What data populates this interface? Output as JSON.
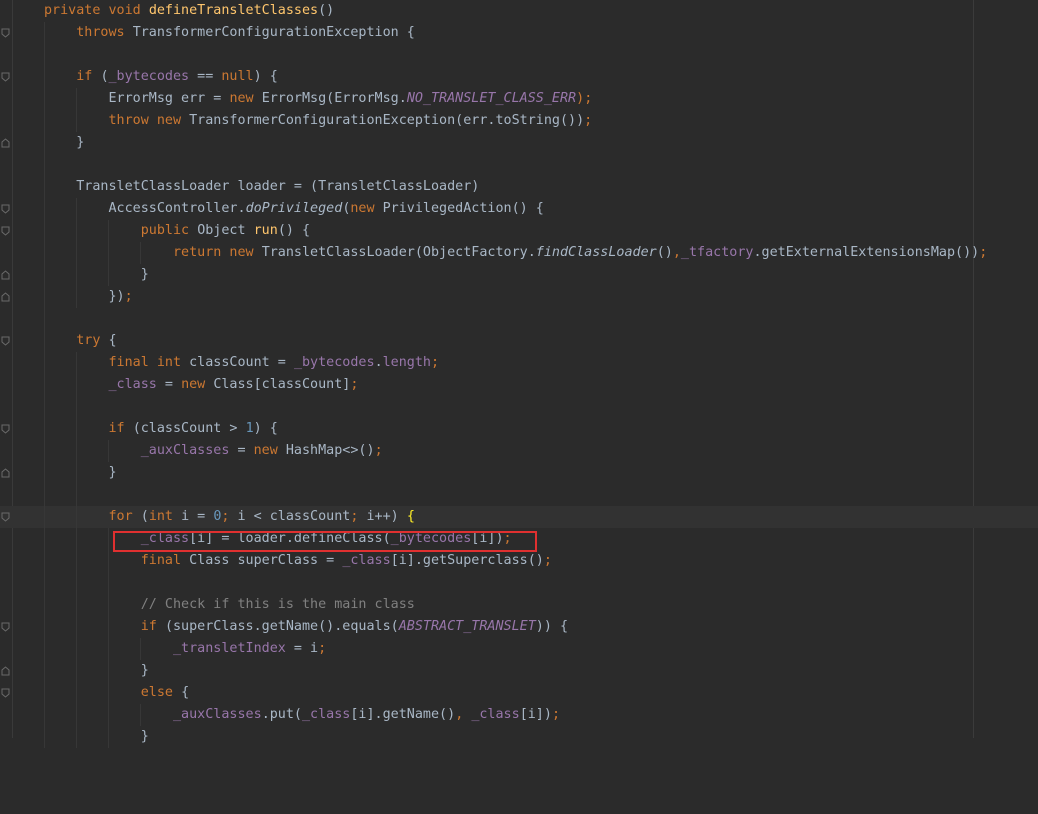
{
  "editor": {
    "colors": {
      "background": "#2b2b2b",
      "keyword": "#cc7832",
      "method_declaration": "#ffc66d",
      "field": "#9876aa",
      "number": "#6897bb",
      "comment": "#808080",
      "default_text": "#a9b7c6",
      "highlight_box": "#e03030"
    },
    "gutter_icons": "fold-marker-icon",
    "highlighted_line": "_class[i] = loader.defineClass(_bytecodes[i]);"
  }
}
